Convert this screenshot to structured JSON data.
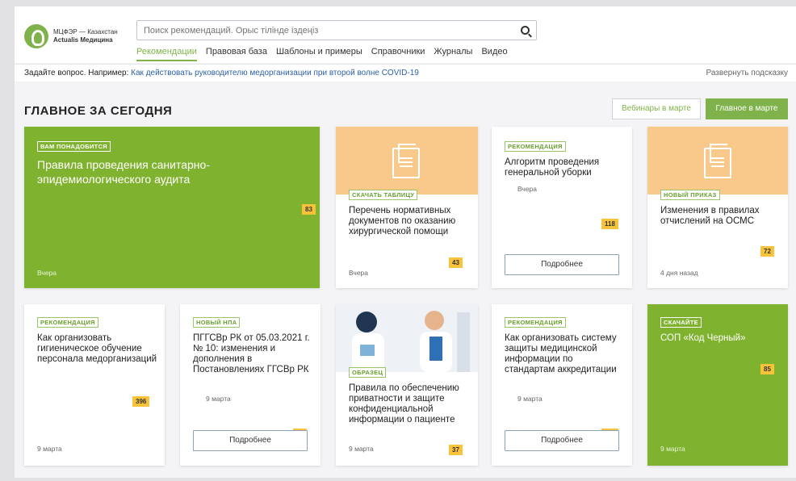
{
  "logo": {
    "line1": "МЦФЭР — Казахстан",
    "line2": "Actualis Медицина"
  },
  "search": {
    "placeholder": "Поиск рекомендаций. Орыс тілінде іздеңіз"
  },
  "nav": [
    {
      "label": "Рекомендации"
    },
    {
      "label": "Правовая база"
    },
    {
      "label": "Шаблоны и примеры"
    },
    {
      "label": "Справочники"
    },
    {
      "label": "Журналы"
    },
    {
      "label": "Видео"
    }
  ],
  "hint": {
    "prefix": "Задайте вопрос. Например: ",
    "link": "Как действовать руководителю медорганизации при второй волне COVID-19",
    "expand": "Развернуть подсказку"
  },
  "section": {
    "title": "ГЛАВНОЕ ЗА СЕГОДНЯ",
    "btn_webinar": "Вебинары в марте",
    "btn_main": "Главное в марте"
  },
  "cards": [
    {
      "tag": "ВАМ ПОНАДОБИТСЯ",
      "title": "Правила проведения санитарно-эпидемиологического аудита",
      "badge": "83",
      "date": "Вчера"
    },
    {
      "tag": "СКАЧАТЬ ТАБЛИЦУ",
      "title": "Перечень нормативных документов по оказанию хирургической помощи",
      "badge": "43",
      "date": "Вчера"
    },
    {
      "tag": "РЕКОМЕНДАЦИЯ",
      "title": "Алгоритм проведения генеральной уборки",
      "date": "Вчера",
      "badge": "118",
      "button": "Подробнее"
    },
    {
      "tag": "НОВЫЙ ПРИКАЗ",
      "title": "Изменения в правилах отчислений на ОСМС",
      "badge": "72",
      "date": "4 дня назад"
    },
    {
      "tag": "РЕКОМЕНДАЦИЯ",
      "title": "Как организовать гигиеническое обучение персонала медорганизаций",
      "badge": "396",
      "date": "9 марта"
    },
    {
      "tag": "НОВЫЙ НПА",
      "title": "ПГГСВр РК от 05.03.2021 г. № 10: изменения и дополнения в Постановлениях ГГСВр РК",
      "date": "9 марта",
      "badge": "98",
      "button": "Подробнее"
    },
    {
      "tag": "ОБРАЗЕЦ",
      "title": "Правила по обеспечению приватности и защите конфиденциальной информации о пациенте",
      "date": "9 марта",
      "badge": "37"
    },
    {
      "tag": "РЕКОМЕНДАЦИЯ",
      "title": "Как организовать систему защиты медицинской информации по стандартам аккредитации",
      "date": "9 марта",
      "badge": "373",
      "button": "Подробнее"
    },
    {
      "tag": "СКАЧАЙТЕ",
      "title": "СОП «Код Черный»",
      "badge": "85",
      "date": "9 марта"
    }
  ]
}
